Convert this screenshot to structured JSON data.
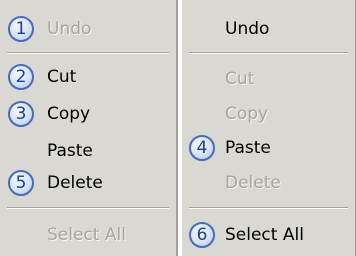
{
  "left_menu": {
    "items": [
      {
        "label": "Undo",
        "badge": "1",
        "enabled": false
      },
      {
        "label": "Cut",
        "badge": "2",
        "enabled": true
      },
      {
        "label": "Copy",
        "badge": "3",
        "enabled": true
      },
      {
        "label": "Paste",
        "badge": "",
        "enabled": true
      },
      {
        "label": "Delete",
        "badge": "5",
        "enabled": true
      },
      {
        "label": "Select All",
        "badge": "",
        "enabled": false
      }
    ]
  },
  "right_menu": {
    "items": [
      {
        "label": "Undo",
        "badge": "",
        "enabled": true
      },
      {
        "label": "Cut",
        "badge": "",
        "enabled": false
      },
      {
        "label": "Copy",
        "badge": "",
        "enabled": false
      },
      {
        "label": "Paste",
        "badge": "4",
        "enabled": true
      },
      {
        "label": "Delete",
        "badge": "",
        "enabled": false
      },
      {
        "label": "Select All",
        "badge": "6",
        "enabled": true
      }
    ]
  }
}
